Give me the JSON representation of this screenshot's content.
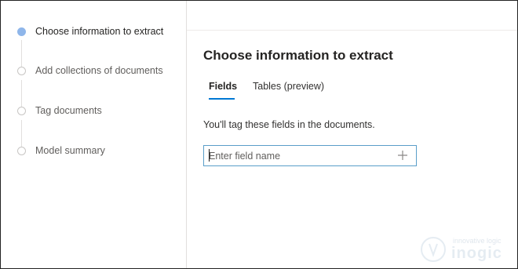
{
  "steps": [
    {
      "label": "Choose information to extract",
      "active": true
    },
    {
      "label": "Add collections of documents",
      "active": false
    },
    {
      "label": "Tag documents",
      "active": false
    },
    {
      "label": "Model summary",
      "active": false
    }
  ],
  "main": {
    "title": "Choose information to extract",
    "tabs": [
      {
        "label": "Fields",
        "selected": true
      },
      {
        "label": "Tables (preview)",
        "selected": false
      }
    ],
    "hint": "You'll tag these fields in the documents.",
    "field_input": {
      "placeholder": "Enter field name",
      "value": ""
    },
    "add_icon": "plus-icon"
  },
  "watermark": {
    "tagline": "innovative logic",
    "brand": "inogic"
  },
  "colors": {
    "active_step": "#8fb6ea",
    "tab_underline": "#0078d4",
    "input_border": "#5a9ec9"
  }
}
